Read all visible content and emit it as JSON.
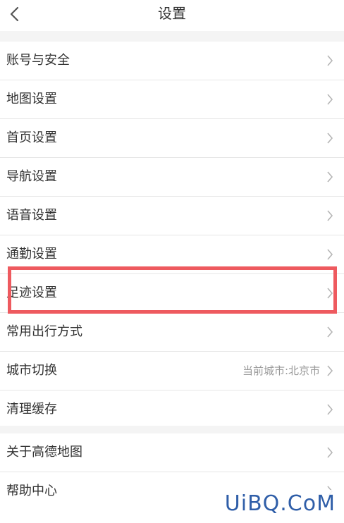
{
  "header": {
    "title": "设置"
  },
  "group1": [
    {
      "label": "账号与安全"
    },
    {
      "label": "地图设置"
    },
    {
      "label": "首页设置"
    },
    {
      "label": "导航设置"
    },
    {
      "label": "语音设置"
    },
    {
      "label": "通勤设置"
    },
    {
      "label": "足迹设置"
    },
    {
      "label": "常用出行方式"
    },
    {
      "label": "城市切换",
      "value": "当前城市:北京市"
    },
    {
      "label": "清理缓存"
    }
  ],
  "group2": [
    {
      "label": "关于高德地图"
    },
    {
      "label": "帮助中心"
    }
  ],
  "watermark": "UiBQ.CoM",
  "colors": {
    "highlight": "#ee5a5f",
    "watermark": "#2f5ea8"
  }
}
